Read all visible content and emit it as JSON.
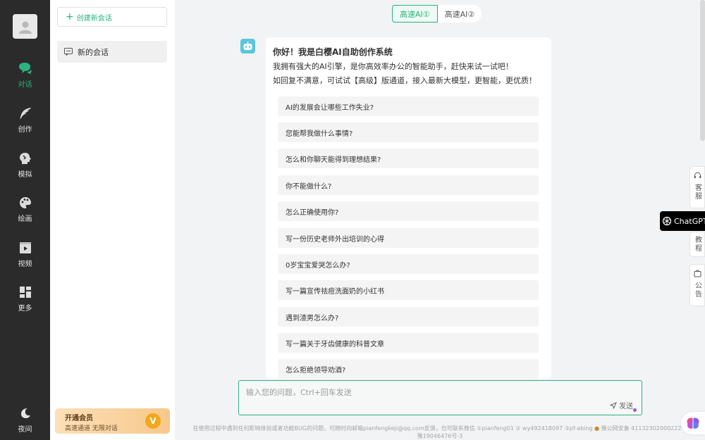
{
  "nav": {
    "items": [
      {
        "label": "对话",
        "icon": "chat-icon"
      },
      {
        "label": "创作",
        "icon": "feather-icon"
      },
      {
        "label": "模拟",
        "icon": "brain-icon"
      },
      {
        "label": "绘画",
        "icon": "palette-icon"
      },
      {
        "label": "视频",
        "icon": "video-icon"
      },
      {
        "label": "更多",
        "icon": "grid-icon"
      }
    ],
    "night_label": "夜间",
    "active_color": "#2bb37f"
  },
  "sessions": {
    "new_chat_label": "创建新会话",
    "items": [
      {
        "label": "新的会话"
      }
    ],
    "vip": {
      "title": "开通会员",
      "subtitle": "高速通道 无限对话",
      "badge": "V"
    }
  },
  "model_tabs": [
    {
      "label": "高速AI①",
      "active": true
    },
    {
      "label": "高速AI②",
      "active": false
    }
  ],
  "greeting": {
    "title": "你好！我是白樱AI自助创作系统",
    "line1": "我拥有强大的AI引擎，是你高效率办公的智能助手，赶快来试一试吧！",
    "line2": "如回复不满意，可试试【高级】版通道，接入最新大模型，更智能，更优质！"
  },
  "suggestions": [
    "AI的发展会让哪些工作失业?",
    "您能帮我做什么事情?",
    "怎么和你聊天能得到理想结果?",
    "你不能做什么?",
    "怎么正确使用你?",
    "写一份历史老师外出培训的心得",
    "0岁宝宝爱哭怎么办?",
    "写一篇宣传祛痘洗面奶的小红书",
    "遇到渣男怎么办?",
    "写一篇关于牙齿健康的科普文章",
    "怎么拒绝领导劝酒?"
  ],
  "input": {
    "placeholder": "输入您的问题，Ctrl+回车发送",
    "send_label": "发送"
  },
  "footer": {
    "line1": "在使用过程中遇到任何影响体验或者功能BUG的问题，可随时向邮箱pianfengkeji@qq.com反馈，也可联系微信 ①pianfeng01 ② wy492418097 ③pf-abing",
    "police": "豫公网安备 41132302000222号",
    "line2": "豫19046476号-3"
  },
  "right_tools": {
    "service": "客服",
    "tutorial": "教程",
    "notice": "公告",
    "chatgpt": "ChatGPT"
  }
}
